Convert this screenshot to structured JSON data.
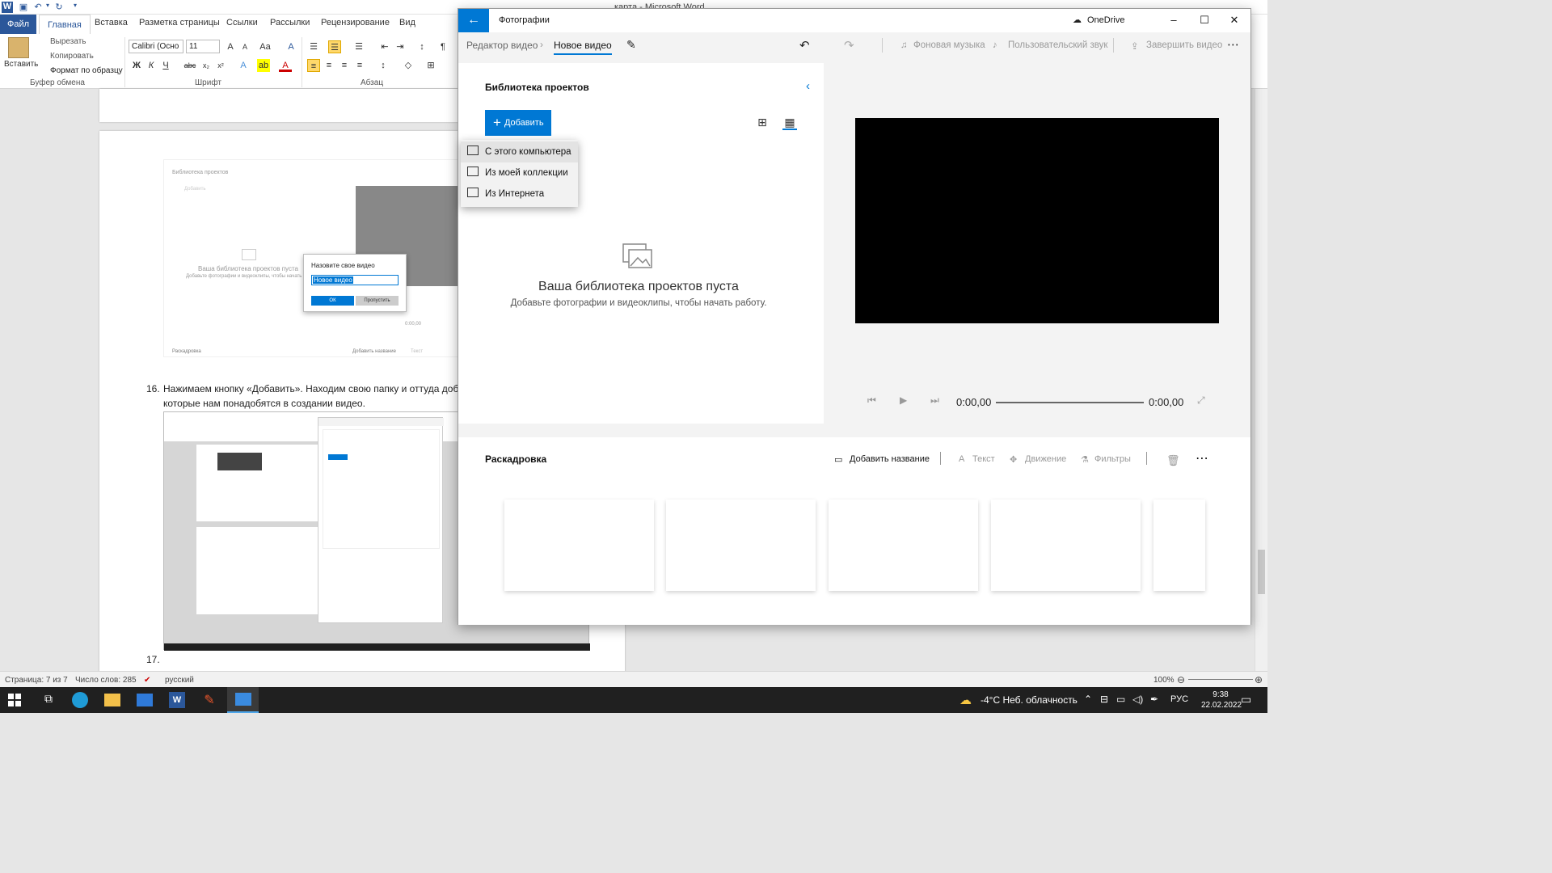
{
  "word": {
    "title": "карта - Microsoft Word",
    "tabs": [
      "Файл",
      "Главная",
      "Вставка",
      "Разметка страницы",
      "Ссылки",
      "Рассылки",
      "Рецензирование",
      "Вид"
    ],
    "clipboard": {
      "paste": "Вставить",
      "cut": "Вырезать",
      "copy": "Копировать",
      "format_painter": "Формат по образцу",
      "group": "Буфер обмена"
    },
    "font": {
      "name": "Calibri (Осно",
      "size": "11",
      "group": "Шрифт"
    },
    "paragraph": {
      "group": "Абзац"
    },
    "document": {
      "embedded_lib_title": "Библиотека проектов",
      "embedded_add": "Добавить",
      "embedded_empty": "Ваша библиотека проектов пуста",
      "embedded_empty_sub": "Добавьте фотографии и видеоклипы, чтобы начать работу.",
      "embedded_dialog_title": "Назовите свое видео",
      "embedded_dialog_value": "Новое видео",
      "embedded_ok": "ОК",
      "embedded_skip": "Пропустить",
      "embedded_story": "Раскадровка",
      "embedded_add_title": "Добавить название",
      "embedded_text": "Текст",
      "embedded_time": "0:00,00",
      "item16_number": "16.",
      "item16_line1": "Нажимаем кнопку «Добавить». Находим свою папку и оттуда доб",
      "item16_line2": "которые нам понадобятся в создании видео.",
      "item17_number": "17."
    },
    "status": {
      "page": "Страница: 7 из 7",
      "words": "Число слов: 285",
      "language": "русский",
      "zoom": "100%"
    }
  },
  "photos": {
    "app_title": "Фотографии",
    "onedrive": "OneDrive",
    "breadcrumb_editor": "Редактор видео",
    "breadcrumb_current": "Новое видео",
    "toolbar": {
      "background_music": "Фоновая музыка",
      "custom_audio": "Пользовательский звук",
      "finish_video": "Завершить видео"
    },
    "library": {
      "title": "Библиотека проектов",
      "add_button": "Добавить",
      "empty_title": "Ваша библиотека проектов пуста",
      "empty_subtitle": "Добавьте фотографии и видеоклипы, чтобы начать работу."
    },
    "add_menu": [
      "С этого компьютера",
      "Из моей коллекции",
      "Из Интернета"
    ],
    "player": {
      "current_time": "0:00,00",
      "end_time": "0:00,00"
    },
    "storyboard": {
      "title": "Раскадровка",
      "add_title": "Добавить название",
      "text": "Текст",
      "motion": "Движение",
      "filters": "Фильтры"
    }
  },
  "taskbar": {
    "weather": "-4°C  Неб. облачность",
    "language": "РУС",
    "time": "9:38",
    "date": "22.02.2022"
  },
  "colors": {
    "accent": "#0078d4",
    "word_blue": "#2b579a",
    "taskbar": "#202020"
  }
}
